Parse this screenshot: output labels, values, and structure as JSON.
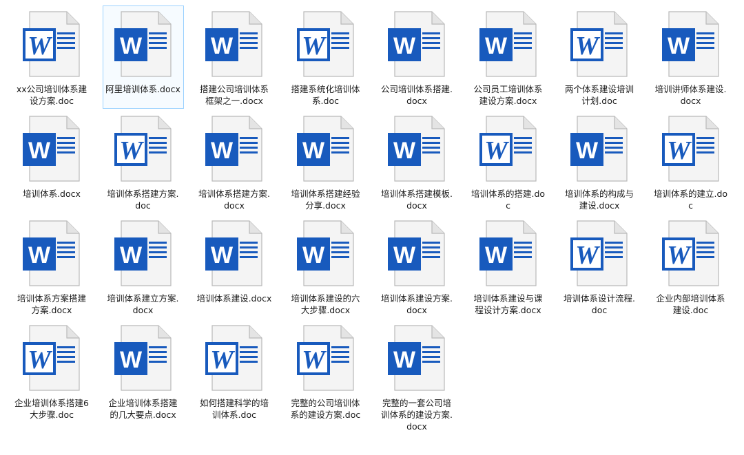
{
  "explorer": {
    "selected_index": 1,
    "icon_colors": {
      "word_blue": "#185abd",
      "word_blue_dark": "#1448a0",
      "page_fill": "#f4f4f4",
      "page_stroke": "#b9b9b9"
    },
    "files": [
      {
        "name": "xx公司培训体系建设方案.doc",
        "icon": "word-classic-icon"
      },
      {
        "name": "阿里培训体系.docx",
        "icon": "word-modern-icon"
      },
      {
        "name": "搭建公司培训体系框架之一.docx",
        "icon": "word-modern-icon"
      },
      {
        "name": "搭建系统化培训体系.doc",
        "icon": "word-classic-icon"
      },
      {
        "name": "公司培训体系搭建.docx",
        "icon": "word-modern-icon"
      },
      {
        "name": "公司员工培训体系建设方案.docx",
        "icon": "word-modern-icon"
      },
      {
        "name": "两个体系建设培训计划.doc",
        "icon": "word-classic-icon"
      },
      {
        "name": "培训讲师体系建设.docx",
        "icon": "word-modern-icon"
      },
      {
        "name": "培训体系.docx",
        "icon": "word-modern-icon"
      },
      {
        "name": "培训体系搭建方案.doc",
        "icon": "word-classic-icon"
      },
      {
        "name": "培训体系搭建方案.docx",
        "icon": "word-modern-icon"
      },
      {
        "name": "培训体系搭建经验分享.docx",
        "icon": "word-modern-icon"
      },
      {
        "name": "培训体系搭建模板.docx",
        "icon": "word-modern-icon"
      },
      {
        "name": "培训体系的搭建.doc",
        "icon": "word-classic-icon"
      },
      {
        "name": "培训体系的构成与建设.docx",
        "icon": "word-modern-icon"
      },
      {
        "name": "培训体系的建立.doc",
        "icon": "word-classic-icon"
      },
      {
        "name": "培训体系方案搭建方案.docx",
        "icon": "word-modern-icon"
      },
      {
        "name": "培训体系建立方案.docx",
        "icon": "word-modern-icon"
      },
      {
        "name": "培训体系建设.docx",
        "icon": "word-modern-icon"
      },
      {
        "name": "培训体系建设的六大步骤.docx",
        "icon": "word-modern-icon"
      },
      {
        "name": "培训体系建设方案.docx",
        "icon": "word-modern-icon"
      },
      {
        "name": "培训体系建设与课程设计方案.docx",
        "icon": "word-modern-icon"
      },
      {
        "name": "培训体系设计流程.doc",
        "icon": "word-classic-icon"
      },
      {
        "name": "企业内部培训体系建设.doc",
        "icon": "word-classic-icon"
      },
      {
        "name": "企业培训体系搭建6大步骤.doc",
        "icon": "word-classic-icon"
      },
      {
        "name": "企业培训体系搭建的几大要点.docx",
        "icon": "word-modern-icon"
      },
      {
        "name": "如何搭建科学的培训体系.doc",
        "icon": "word-classic-icon"
      },
      {
        "name": "完整的公司培训体系的建设方案.doc",
        "icon": "word-classic-icon"
      },
      {
        "name": "完整的一套公司培训体系的建设方案.docx",
        "icon": "word-modern-icon"
      }
    ]
  }
}
